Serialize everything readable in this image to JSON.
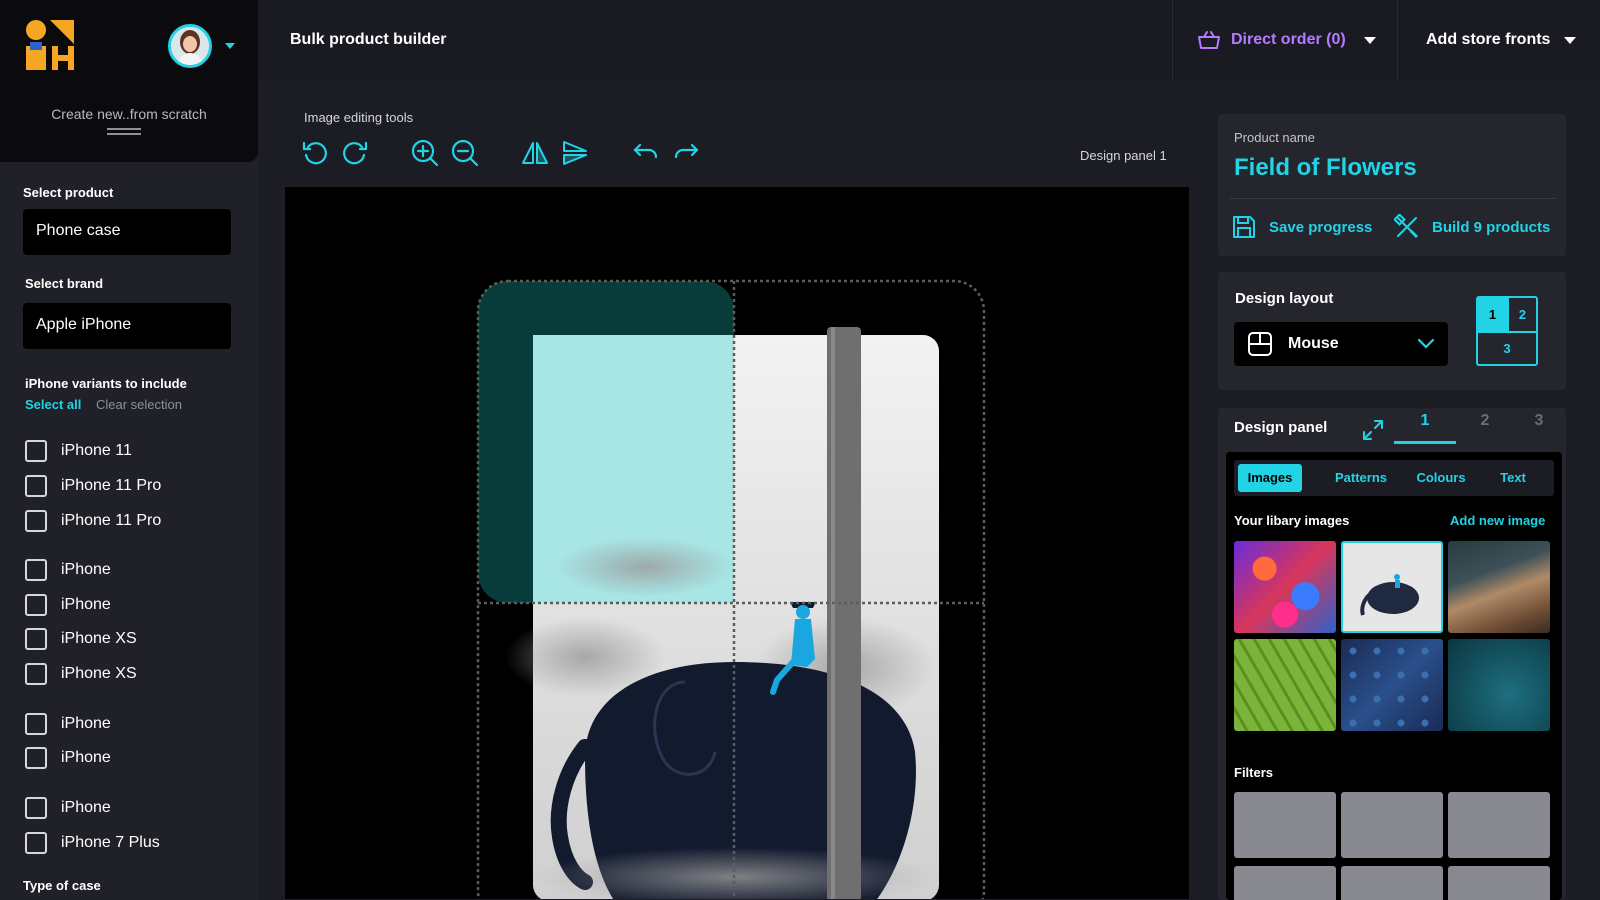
{
  "app": {
    "page_title": "Bulk product builder",
    "create_label": "Create new..from scratch"
  },
  "topbar": {
    "order_label": "Direct order (0)",
    "store_label": "Add store fronts"
  },
  "sidebar": {
    "product_label": "Select product",
    "product_value": "Phone case",
    "brand_label": "Select brand",
    "brand_value": "Apple iPhone",
    "variants_label": "iPhone variants to include",
    "select_all": "Select all",
    "clear_selection": "Clear selection",
    "variants": [
      {
        "label": "iPhone 11",
        "checked": false
      },
      {
        "label": "iPhone 11 Pro",
        "checked": false
      },
      {
        "label": "iPhone 11 Pro",
        "checked": false
      },
      {
        "label": "iPhone",
        "checked": false
      },
      {
        "label": "iPhone",
        "checked": false
      },
      {
        "label": "iPhone XS",
        "checked": false
      },
      {
        "label": "iPhone XS",
        "checked": false
      },
      {
        "label": "iPhone",
        "checked": false
      },
      {
        "label": "iPhone",
        "checked": false
      },
      {
        "label": "iPhone",
        "checked": false
      },
      {
        "label": "iPhone 7 Plus",
        "checked": false
      }
    ],
    "type_label": "Type of case"
  },
  "tools": {
    "label": "Image editing tools",
    "panel_indicator": "Design panel 1",
    "icons": [
      "rotate-left-icon",
      "rotate-right-icon",
      "zoom-in-icon",
      "zoom-out-icon",
      "flip-horizontal-icon",
      "flip-vertical-icon",
      "undo-icon",
      "redo-icon"
    ]
  },
  "product": {
    "name_label": "Product name",
    "name_value": "Field of Flowers",
    "save_label": "Save progress",
    "build_label": "Build 9 products"
  },
  "layout": {
    "label": "Design layout",
    "selected": "Mouse",
    "grid": [
      "1",
      "2",
      "3"
    ],
    "active_cell": "1"
  },
  "design_panel": {
    "label": "Design panel",
    "tabs": [
      "1",
      "2",
      "3"
    ],
    "active_tab": "1",
    "segments": [
      "Images",
      "Patterns",
      "Colours",
      "Text"
    ],
    "active_segment": "Images",
    "library_label": "Your libary images",
    "add_image": "Add new image",
    "filters_label": "Filters",
    "accent": "#22d3e6"
  }
}
